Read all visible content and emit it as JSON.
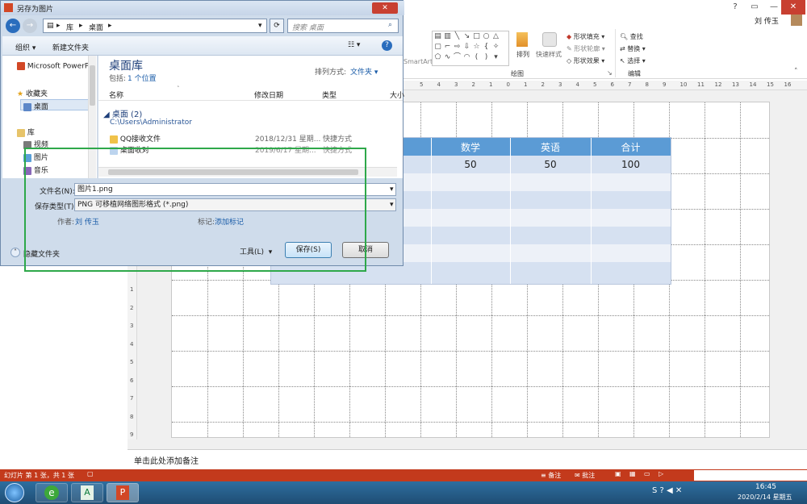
{
  "dialog": {
    "title": "另存为图片",
    "breadcrumb": [
      "库",
      "桌面"
    ],
    "search_placeholder": "搜索 桌面",
    "organize": "组织 ▾",
    "new_folder": "新建文件夹",
    "nav": {
      "recent": "Microsoft PowerPo",
      "favorites": "收藏夹",
      "desktop": "桌面",
      "libraries": "库",
      "videos": "视频",
      "pictures": "图片",
      "music": "音乐"
    },
    "library_title": "桌面库",
    "includes_label": "包括:",
    "includes_value": "1 个位置",
    "sort_label": "排列方式:",
    "sort_value": "文件夹 ▾",
    "columns": [
      "名称",
      "修改日期",
      "类型",
      "大小"
    ],
    "group_header": "桌面 (2)",
    "group_path": "C:\\Users\\Administrator",
    "files": [
      {
        "name": "QQ接收文件",
        "date": "2018/12/31 星期...",
        "type": "快捷方式"
      },
      {
        "name": "桌面收对",
        "date": "2019/6/17 星期...",
        "type": "快捷方式"
      }
    ],
    "filename_label": "文件名(N):",
    "filename_value": "图片1.png",
    "filetype_label": "保存类型(T):",
    "filetype_value": "PNG 可移植网络图形格式 (*.png)",
    "author_label": "作者:",
    "author_value": "刘 传玉",
    "tags_label": "标记:",
    "tags_value": "添加标记",
    "hide_folders": "隐藏文件夹",
    "tools": "工具(L)",
    "save": "保存(S)",
    "cancel": "取消"
  },
  "ppt": {
    "user": "刘 传玉",
    "ribbon": {
      "smartart": "SmartArt",
      "arrange": "排列",
      "quick_styles": "快速样式",
      "shape_fill": "形状填充 ▾",
      "shape_outline": "形状轮廓 ▾",
      "shape_effects": "形状效果 ▾",
      "find": "查找",
      "replace": "替换 ▾",
      "select": "选择 ▾",
      "drawing_group": "绘图",
      "editing_group": "编辑"
    },
    "table": {
      "headers": [
        "数学",
        "英语",
        "合计"
      ],
      "row1": [
        "50",
        "50",
        "100"
      ]
    },
    "notes": "单击此处添加备注",
    "status_left": "幻灯片 第 1 张，共 1 张",
    "status_notes": "备注",
    "status_comments": "批注",
    "ruler_h": [
      "5",
      "4",
      "3",
      "2",
      "1",
      "0",
      "1",
      "2",
      "3",
      "4",
      "5",
      "6",
      "7",
      "8",
      "9",
      "10",
      "11",
      "12",
      "13",
      "14",
      "15",
      "16"
    ],
    "ruler_v": [
      "1",
      "2",
      "3",
      "4",
      "5",
      "6",
      "7",
      "8",
      "9"
    ]
  },
  "taskbar": {
    "time": "16:45",
    "date": "2020/2/14 星期五"
  },
  "colors": {
    "accent": "#5b9bd5",
    "highlight": "#2ea84a",
    "status": "#c33a1c"
  }
}
